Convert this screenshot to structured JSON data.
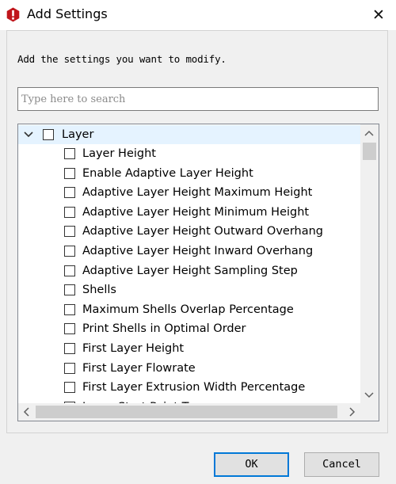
{
  "window": {
    "title": "Add Settings",
    "close_glyph": "✕",
    "app_icon": "settings-app-icon"
  },
  "instructions": "Add the settings you want to modify.",
  "search": {
    "placeholder": "Type here to search",
    "value": ""
  },
  "tree": {
    "group": {
      "label": "Layer",
      "expanded": true,
      "checked": false
    },
    "items": [
      {
        "label": "Layer Height",
        "checked": false
      },
      {
        "label": "Enable Adaptive Layer Height",
        "checked": false
      },
      {
        "label": "Adaptive Layer Height Maximum Height",
        "checked": false
      },
      {
        "label": "Adaptive Layer Height Minimum Height",
        "checked": false
      },
      {
        "label": "Adaptive Layer Height Outward Overhang",
        "checked": false
      },
      {
        "label": "Adaptive Layer Height Inward Overhang",
        "checked": false
      },
      {
        "label": "Adaptive Layer Height Sampling Step",
        "checked": false
      },
      {
        "label": "Shells",
        "checked": false
      },
      {
        "label": "Maximum Shells Overlap Percentage",
        "checked": false
      },
      {
        "label": "Print Shells in Optimal Order",
        "checked": false
      },
      {
        "label": "First Layer Height",
        "checked": false
      },
      {
        "label": "First Layer Flowrate",
        "checked": false
      },
      {
        "label": "First Layer Extrusion Width Percentage",
        "checked": false
      },
      {
        "label": "Layer Start Point Type",
        "checked": false
      }
    ]
  },
  "buttons": {
    "ok": "OK",
    "cancel": "Cancel"
  },
  "colors": {
    "accent": "#0078d7",
    "selection": "#e5f3ff",
    "icon_red": "#c0161c"
  }
}
